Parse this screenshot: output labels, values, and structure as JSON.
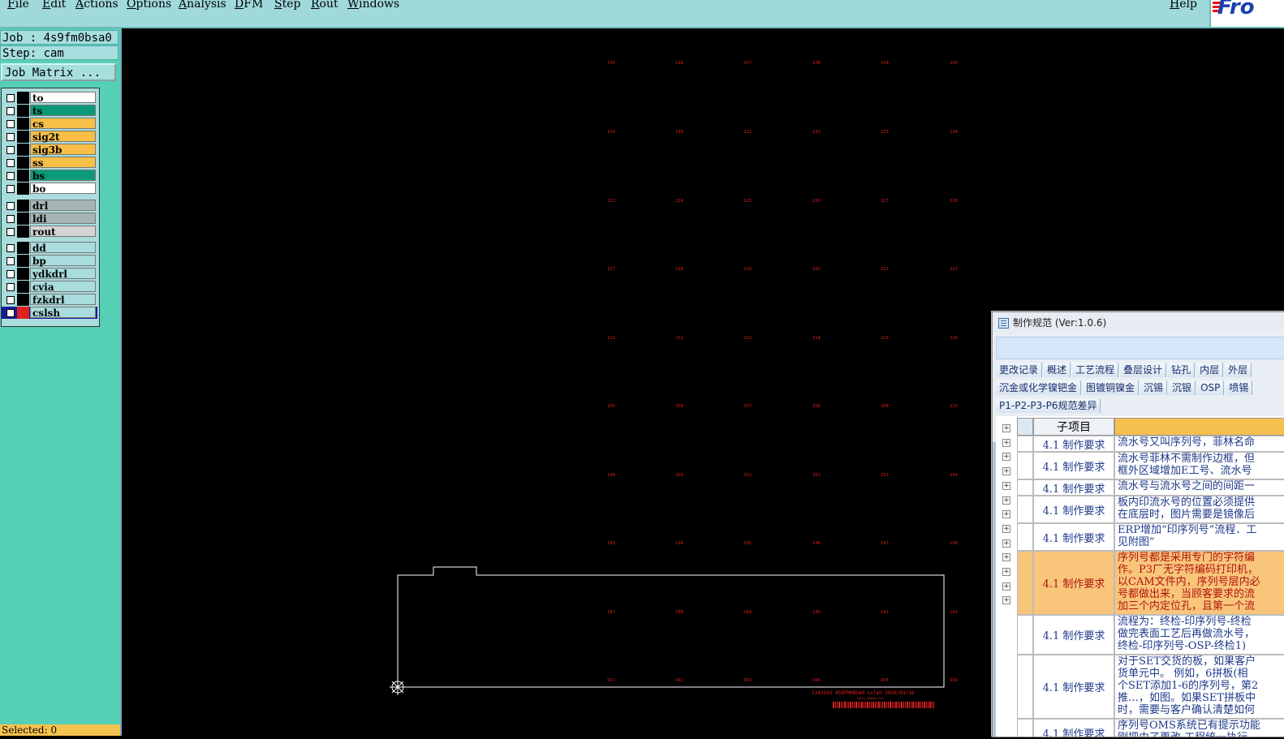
{
  "menu": [
    "File",
    "Edit",
    "Actions",
    "Options",
    "Analysis",
    "DFM",
    "Step",
    "Rout",
    "Windows"
  ],
  "menu_help": "Help",
  "logo_text": "Fro",
  "job_label": "Job : 4s9fm0bsa0",
  "step_label": "Step: cam",
  "job_matrix_button": "Job Matrix ...",
  "layers": [
    {
      "name": "to",
      "color": "#ffffff"
    },
    {
      "name": "ts",
      "color": "#0a9a78"
    },
    {
      "name": "cs",
      "color": "#f7bf48"
    },
    {
      "name": "sig2t",
      "color": "#f7bf48"
    },
    {
      "name": "sig3b",
      "color": "#f7bf48"
    },
    {
      "name": "ss",
      "color": "#f7bf48"
    },
    {
      "name": "bs",
      "color": "#0a9a78"
    },
    {
      "name": "bo",
      "color": "#ffffff"
    },
    {
      "name": "drl",
      "color": "#a6b4b4"
    },
    {
      "name": "ldi",
      "color": "#a6b4b4"
    },
    {
      "name": "rout",
      "color": "#d5d5d5"
    },
    {
      "name": "dd",
      "color": "#a9dcdc"
    },
    {
      "name": "bp",
      "color": "#a9dcdc"
    },
    {
      "name": "ydkdrl",
      "color": "#a9dcdc"
    },
    {
      "name": "cvia",
      "color": "#a9dcdc"
    },
    {
      "name": "fzkdrl",
      "color": "#a9dcdc"
    },
    {
      "name": "cslsh",
      "color": "#a9dcdc",
      "active": true
    }
  ],
  "bottom_strip": "Selected: 0",
  "dialog": {
    "title": "制作规范 (Ver:1.0.6)",
    "tabs_row1": [
      "更改记录",
      "概述",
      "工艺流程",
      "叠层设计",
      "钻孔",
      "内层",
      "外层"
    ],
    "tabs_row2": [
      "沉金或化学镍钯金",
      "图镀铜镍金",
      "沉锡",
      "沉银",
      "OSP",
      "喷锡"
    ],
    "tabs_row3": [
      "P1-P2-P3-P6规范差异"
    ],
    "header_col": "子项目",
    "rows": [
      {
        "item": "4.1 制作要求",
        "text": "流水号又叫序列号，菲林名命",
        "hl": false
      },
      {
        "item": "4.1 制作要求",
        "text": "流水号菲林不需制作边框，但\n框外区域增加E工号、流水号",
        "hl": false
      },
      {
        "item": "4.1 制作要求",
        "text": "流水号与流水号之间的间距一",
        "hl": false
      },
      {
        "item": "4.1 制作要求",
        "text": "板内印流水号的位置必须提供\n在底层时，图片需要是镜像后",
        "hl": false
      },
      {
        "item": "4.1 制作要求",
        "text": "ERP增加“印序列号”流程．工\n见附图”",
        "hl": false
      },
      {
        "item": "4.1 制作要求",
        "text": "序列号都是采用专门的字符编\n作。P3厂无字符编码打印机，\n以CAM文件内，序列号层内必\n号都做出来，当顾客要求的流\n加三个内定位孔，且第一个流",
        "hl": true
      },
      {
        "item": "4.1 制作要求",
        "text": "流程为：终检-印序列号-终检\n做完表面工艺后再做流水号，\n终检-印序列号-OSP-终检1)",
        "hl": false
      },
      {
        "item": "4.1 制作要求",
        "text": "对于SET交货的板，如果客户\n货单元中。 例如，6拼板(相\n个SET添加1-6的序列号，第2\n推…，如图。如果SET拼板中\n时，需要与客户确认清楚如何",
        "hl": false
      },
      {
        "item": "4.1 制作要求",
        "text": "序列号OMS系统已有提示功能\n刚把由了更改 工程统一执行",
        "hl": false
      }
    ]
  },
  "canvas": {
    "board_label": "1343103 4S9FM0BSA0 ssleh 2020/03/16",
    "board_sublabel": "SERIAL NUMBER FILM",
    "serial_labels": [
      [
        "235",
        "236",
        "237",
        "238",
        "239",
        "240"
      ],
      [
        "229",
        "230",
        "231",
        "232",
        "233",
        "234"
      ],
      [
        "223",
        "224",
        "225",
        "226",
        "227",
        "228"
      ],
      [
        "217",
        "218",
        "219",
        "220",
        "221",
        "222"
      ],
      [
        "211",
        "212",
        "213",
        "214",
        "215",
        "216"
      ],
      [
        "205",
        "206",
        "207",
        "208",
        "209",
        "210"
      ],
      [
        "199",
        "200",
        "201",
        "202",
        "203",
        "204"
      ],
      [
        "193",
        "194",
        "195",
        "196",
        "197",
        "198"
      ],
      [
        "187",
        "188",
        "189",
        "190",
        "191",
        "192"
      ],
      [
        "001",
        "002",
        "003",
        "004",
        "005",
        "006"
      ]
    ],
    "accent_red": "#e0201c",
    "outline_color": "#ffffff"
  }
}
